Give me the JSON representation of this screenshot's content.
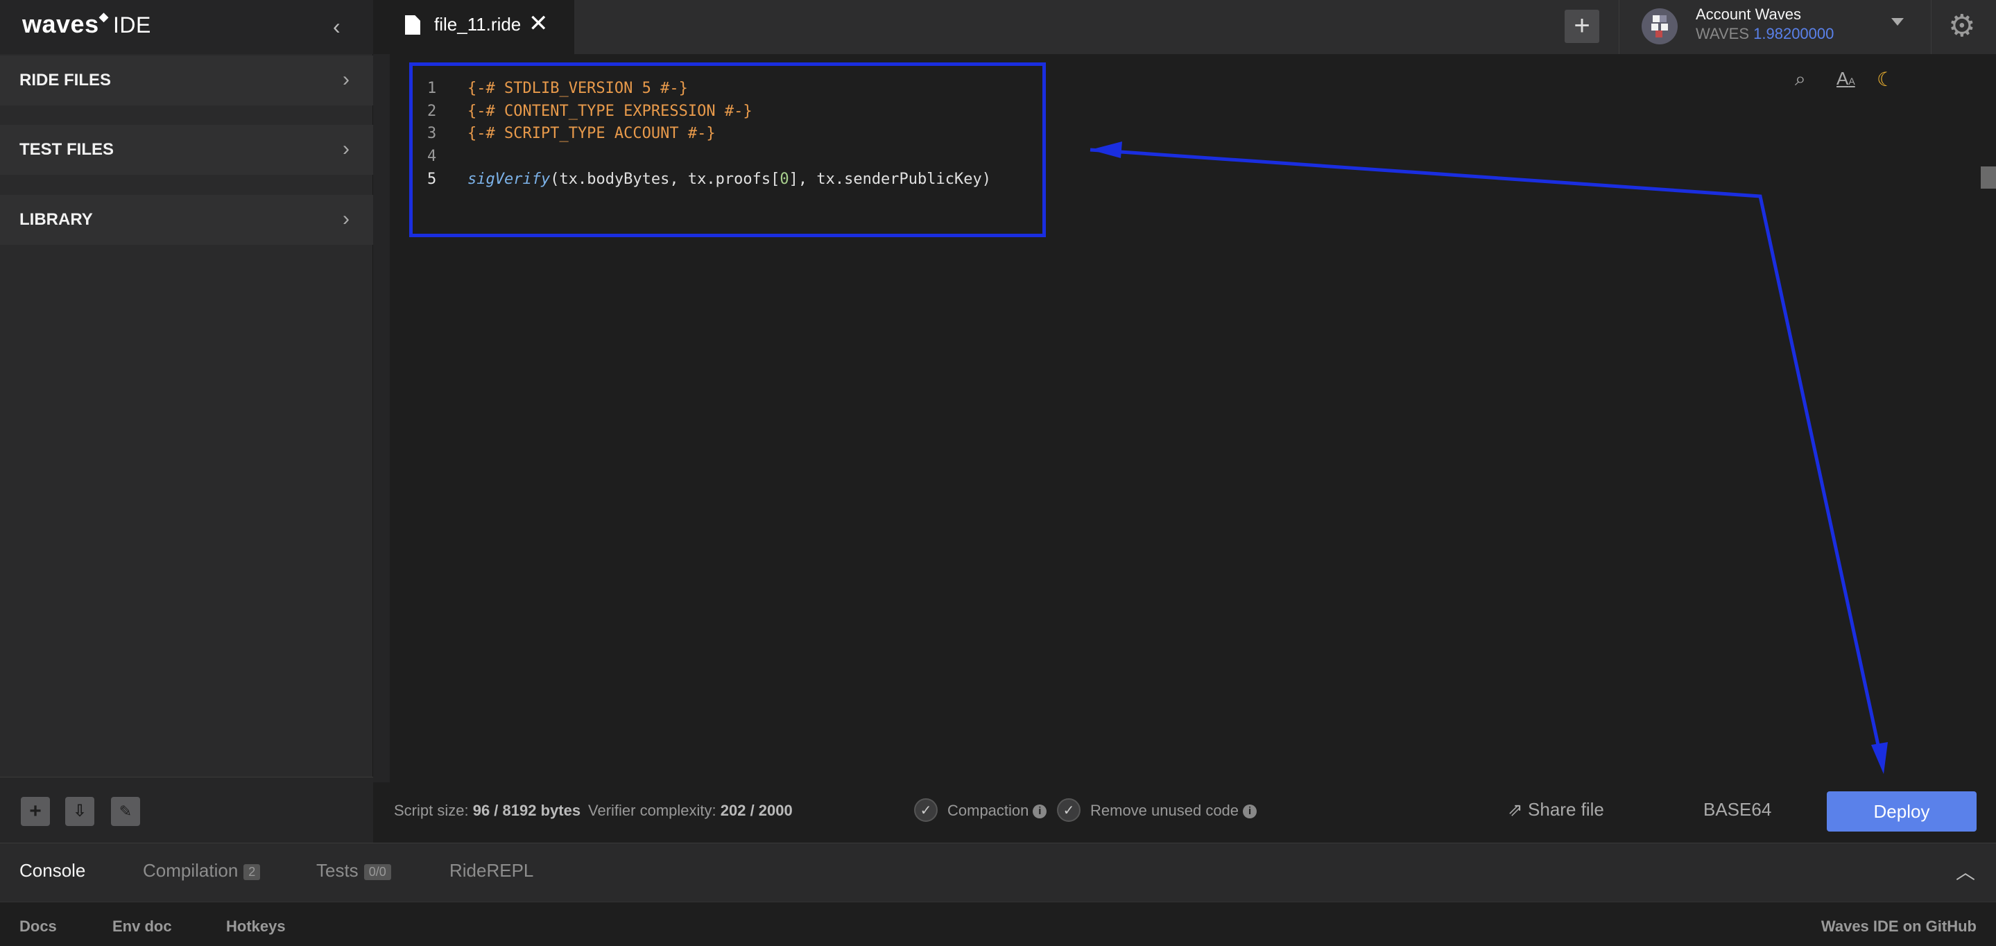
{
  "logo": {
    "brand": "waves",
    "product": "IDE"
  },
  "sidebar": {
    "sections": [
      {
        "label": "RIDE FILES"
      },
      {
        "label": "TEST FILES"
      },
      {
        "label": "LIBRARY"
      }
    ]
  },
  "tabs": [
    {
      "label": "file_11.ride"
    }
  ],
  "account": {
    "name": "Account Waves",
    "currency": "WAVES",
    "balance": "1.98200000"
  },
  "editor": {
    "lines": [
      {
        "num": "1",
        "text": "{-# STDLIB_VERSION 5 #-}"
      },
      {
        "num": "2",
        "text": "{-# CONTENT_TYPE EXPRESSION #-}"
      },
      {
        "num": "3",
        "text": "{-# SCRIPT_TYPE ACCOUNT #-}"
      },
      {
        "num": "4",
        "text": ""
      },
      {
        "num": "5",
        "fn": "sigVerify",
        "args_a": "(tx.bodyBytes, tx.proofs[",
        "index": "0",
        "args_b": "], tx.senderPublicKey)"
      }
    ]
  },
  "status": {
    "script_size_label": "Script size:",
    "script_size_value": "96 / 8192 bytes",
    "complexity_label": "Verifier complexity:",
    "complexity_value": "202 / 2000",
    "compaction_label": "Compaction",
    "remove_unused_label": "Remove unused code",
    "share_label": "Share file",
    "base64_label": "BASE64",
    "deploy_label": "Deploy"
  },
  "console": {
    "tabs": [
      {
        "label": "Console"
      },
      {
        "label": "Compilation",
        "badge": "2"
      },
      {
        "label": "Tests",
        "badge": "0/0"
      },
      {
        "label": "RideREPL"
      }
    ]
  },
  "footer": {
    "links": [
      "Docs",
      "Env doc",
      "Hotkeys"
    ],
    "github": "Waves IDE on GitHub"
  },
  "colors": {
    "accent": "#5a81ea",
    "annotation": "#1a2ee0",
    "directive": "#e89a4b"
  }
}
